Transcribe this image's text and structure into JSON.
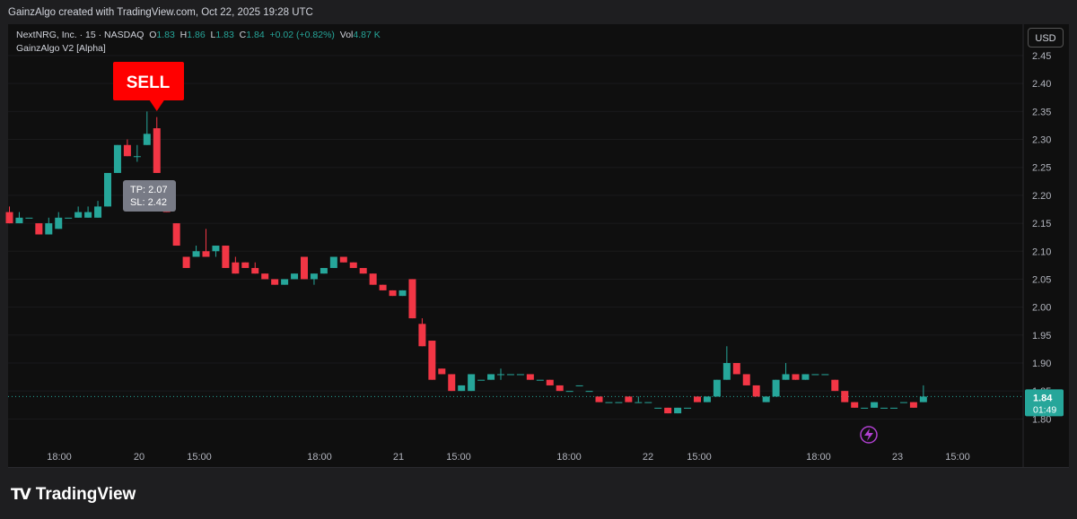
{
  "header": {
    "attribution": "GainzAlgo created with TradingView.com, Oct 22, 2025 19:28 UTC"
  },
  "legend": {
    "symbol": "NextNRG, Inc. · 15 · NASDAQ",
    "o_label": "O",
    "o": "1.83",
    "h_label": "H",
    "h": "1.86",
    "l_label": "L",
    "l": "1.83",
    "c_label": "C",
    "c": "1.84",
    "change": "+0.02 (+0.82%)",
    "vol_label": "Vol",
    "vol": "4.87 K",
    "indicator": "GainzAlgo V2 [Alpha]"
  },
  "currency_button": "USD",
  "brand": {
    "logo": "TV",
    "name": "TradingView"
  },
  "colors": {
    "up": "#26a69a",
    "down": "#f23645",
    "background": "#0f0f0f",
    "sell": "#ff0000",
    "price_line": "#26a69a"
  },
  "icons": {
    "alert": "lightning-bolt-icon"
  },
  "chart_data": {
    "type": "candlestick",
    "x_ticks": [
      "18:00",
      "20",
      "15:00",
      "18:00",
      "21",
      "15:00",
      "18:00",
      "22",
      "15:00",
      "18:00",
      "23",
      "15:00"
    ],
    "y_ticks": [
      "2.45",
      "2.40",
      "2.35",
      "2.30",
      "2.25",
      "2.20",
      "2.15",
      "2.10",
      "2.05",
      "2.00",
      "1.95",
      "1.90",
      "1.85",
      "1.80"
    ],
    "ylim": [
      1.75,
      2.47
    ],
    "last_price": "1.84",
    "countdown": "01:49",
    "signal": {
      "label": "SELL",
      "tp": "TP: 2.07",
      "sl": "SL: 2.42"
    },
    "candles": [
      [
        2.17,
        2.18,
        2.15,
        2.15
      ],
      [
        2.15,
        2.17,
        2.15,
        2.16
      ],
      [
        2.16,
        2.16,
        2.16,
        2.16
      ],
      [
        2.15,
        2.15,
        2.13,
        2.13
      ],
      [
        2.13,
        2.16,
        2.13,
        2.15
      ],
      [
        2.14,
        2.17,
        2.14,
        2.16
      ],
      [
        2.16,
        2.16,
        2.16,
        2.16
      ],
      [
        2.16,
        2.18,
        2.16,
        2.17
      ],
      [
        2.16,
        2.18,
        2.16,
        2.17
      ],
      [
        2.16,
        2.19,
        2.16,
        2.18
      ],
      [
        2.18,
        2.24,
        2.18,
        2.24
      ],
      [
        2.24,
        2.29,
        2.24,
        2.29
      ],
      [
        2.29,
        2.3,
        2.27,
        2.27
      ],
      [
        2.27,
        2.29,
        2.26,
        2.27
      ],
      [
        2.29,
        2.35,
        2.29,
        2.31
      ],
      [
        2.32,
        2.34,
        2.24,
        2.24
      ],
      [
        2.22,
        2.22,
        2.17,
        2.17
      ],
      [
        2.15,
        2.15,
        2.11,
        2.11
      ],
      [
        2.09,
        2.09,
        2.07,
        2.07
      ],
      [
        2.09,
        2.11,
        2.09,
        2.1
      ],
      [
        2.1,
        2.14,
        2.09,
        2.09
      ],
      [
        2.1,
        2.11,
        2.09,
        2.11
      ],
      [
        2.11,
        2.11,
        2.07,
        2.07
      ],
      [
        2.08,
        2.09,
        2.06,
        2.06
      ],
      [
        2.08,
        2.08,
        2.07,
        2.07
      ],
      [
        2.07,
        2.08,
        2.06,
        2.06
      ],
      [
        2.06,
        2.06,
        2.05,
        2.05
      ],
      [
        2.05,
        2.05,
        2.04,
        2.04
      ],
      [
        2.04,
        2.05,
        2.04,
        2.05
      ],
      [
        2.05,
        2.06,
        2.05,
        2.06
      ],
      [
        2.09,
        2.09,
        2.05,
        2.05
      ],
      [
        2.05,
        2.06,
        2.04,
        2.06
      ],
      [
        2.06,
        2.07,
        2.06,
        2.07
      ],
      [
        2.07,
        2.09,
        2.07,
        2.09
      ],
      [
        2.09,
        2.09,
        2.08,
        2.08
      ],
      [
        2.08,
        2.08,
        2.07,
        2.07
      ],
      [
        2.07,
        2.07,
        2.06,
        2.06
      ],
      [
        2.06,
        2.06,
        2.04,
        2.04
      ],
      [
        2.04,
        2.04,
        2.03,
        2.03
      ],
      [
        2.03,
        2.03,
        2.02,
        2.02
      ],
      [
        2.02,
        2.03,
        2.02,
        2.03
      ],
      [
        2.05,
        2.05,
        1.98,
        1.98
      ],
      [
        1.97,
        1.98,
        1.93,
        1.93
      ],
      [
        1.94,
        1.94,
        1.87,
        1.87
      ],
      [
        1.89,
        1.89,
        1.88,
        1.88
      ],
      [
        1.88,
        1.88,
        1.85,
        1.85
      ],
      [
        1.85,
        1.86,
        1.85,
        1.86
      ],
      [
        1.85,
        1.88,
        1.85,
        1.88
      ],
      [
        1.87,
        1.87,
        1.87,
        1.87
      ],
      [
        1.87,
        1.88,
        1.87,
        1.88
      ],
      [
        1.88,
        1.89,
        1.87,
        1.88
      ],
      [
        1.88,
        1.88,
        1.88,
        1.88
      ],
      [
        1.88,
        1.88,
        1.88,
        1.88
      ],
      [
        1.88,
        1.88,
        1.87,
        1.87
      ],
      [
        1.87,
        1.87,
        1.87,
        1.87
      ],
      [
        1.87,
        1.87,
        1.86,
        1.86
      ],
      [
        1.86,
        1.86,
        1.85,
        1.85
      ],
      [
        1.85,
        1.85,
        1.85,
        1.85
      ],
      [
        1.86,
        1.86,
        1.86,
        1.86
      ],
      [
        1.85,
        1.85,
        1.85,
        1.85
      ],
      [
        1.84,
        1.84,
        1.83,
        1.83
      ],
      [
        1.83,
        1.83,
        1.83,
        1.83
      ],
      [
        1.83,
        1.83,
        1.83,
        1.83
      ],
      [
        1.84,
        1.84,
        1.83,
        1.83
      ],
      [
        1.83,
        1.84,
        1.83,
        1.83
      ],
      [
        1.83,
        1.83,
        1.83,
        1.83
      ],
      [
        1.82,
        1.82,
        1.82,
        1.82
      ],
      [
        1.82,
        1.82,
        1.81,
        1.81
      ],
      [
        1.81,
        1.82,
        1.81,
        1.82
      ],
      [
        1.82,
        1.82,
        1.82,
        1.82
      ],
      [
        1.84,
        1.84,
        1.83,
        1.83
      ],
      [
        1.83,
        1.84,
        1.83,
        1.84
      ],
      [
        1.84,
        1.87,
        1.84,
        1.87
      ],
      [
        1.87,
        1.93,
        1.87,
        1.9
      ],
      [
        1.9,
        1.9,
        1.88,
        1.88
      ],
      [
        1.88,
        1.88,
        1.86,
        1.86
      ],
      [
        1.86,
        1.86,
        1.84,
        1.84
      ],
      [
        1.83,
        1.84,
        1.83,
        1.84
      ],
      [
        1.84,
        1.87,
        1.84,
        1.87
      ],
      [
        1.87,
        1.9,
        1.87,
        1.88
      ],
      [
        1.88,
        1.88,
        1.87,
        1.87
      ],
      [
        1.87,
        1.88,
        1.87,
        1.88
      ],
      [
        1.88,
        1.88,
        1.88,
        1.88
      ],
      [
        1.88,
        1.88,
        1.88,
        1.88
      ],
      [
        1.87,
        1.87,
        1.85,
        1.85
      ],
      [
        1.85,
        1.85,
        1.83,
        1.83
      ],
      [
        1.83,
        1.83,
        1.82,
        1.82
      ],
      [
        1.82,
        1.82,
        1.82,
        1.82
      ],
      [
        1.82,
        1.83,
        1.82,
        1.83
      ],
      [
        1.82,
        1.82,
        1.82,
        1.82
      ],
      [
        1.82,
        1.82,
        1.82,
        1.82
      ],
      [
        1.83,
        1.83,
        1.83,
        1.83
      ],
      [
        1.83,
        1.83,
        1.82,
        1.82
      ],
      [
        1.83,
        1.86,
        1.83,
        1.84
      ]
    ]
  }
}
